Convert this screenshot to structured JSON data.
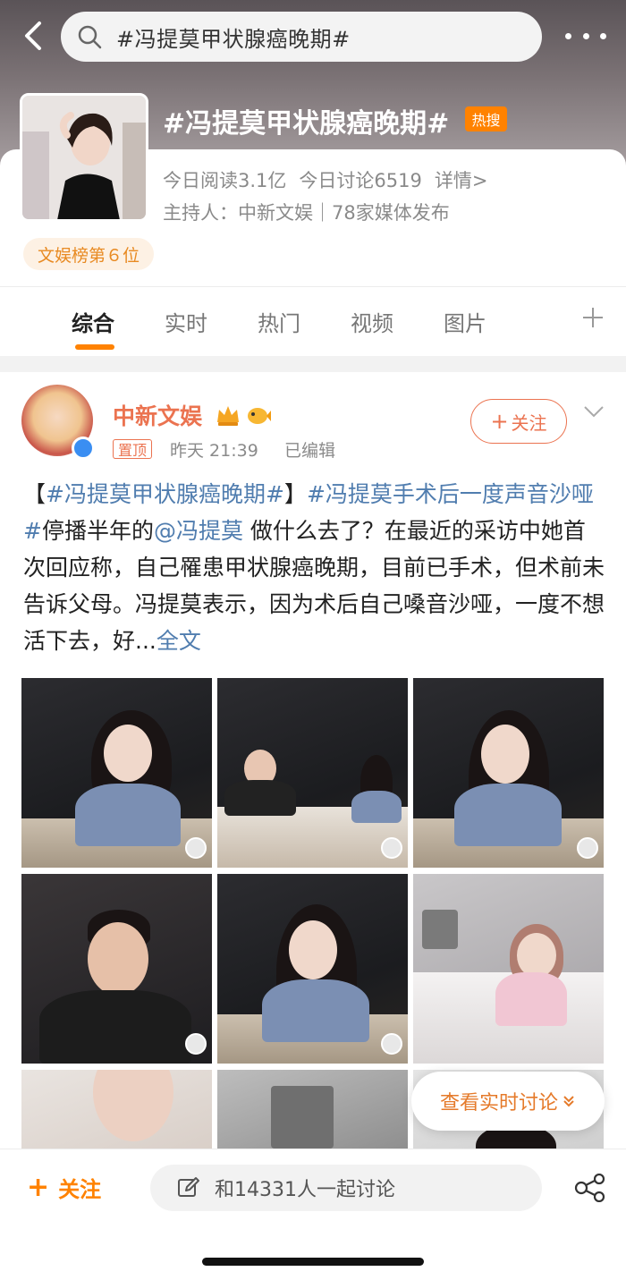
{
  "search": {
    "query": "#冯提莫甲状腺癌晚期#"
  },
  "topic": {
    "title": "#冯提莫甲状腺癌晚期#",
    "hot_badge": "热搜",
    "reads": "今日阅读3.1亿",
    "discussions": "今日讨论6519",
    "details": "详情>",
    "host": "主持人：中新文娱｜78家媒体发布",
    "rank": "文娱榜第６位"
  },
  "tabs": [
    {
      "label": "综合",
      "active": true
    },
    {
      "label": "实时",
      "active": false
    },
    {
      "label": "热门",
      "active": false
    },
    {
      "label": "视频",
      "active": false
    },
    {
      "label": "图片",
      "active": false
    }
  ],
  "post": {
    "author": "中新文娱",
    "pin_label": "置顶",
    "time": "昨天 21:39",
    "edited": "已编辑",
    "follow_label": "关注",
    "text": {
      "p1": "【",
      "tag1": "#冯提莫甲状腺癌晚期#",
      "p2": "】",
      "tag2": "#冯提莫手术后一度声音沙哑#",
      "p3": "停播半年的",
      "mention": "@冯提莫",
      "p4": " 做什么去了？在最近的采访中她首次回应称，自己罹患甲状腺癌晚期，目前已手术，但术前未告诉父母。冯提莫表示，因为术后自己嗓音沙哑，一度不想活下去，好...",
      "more": "全文"
    }
  },
  "live_discuss": "查看实时讨论",
  "bottom": {
    "follow_label": "关注",
    "discuss_placeholder": "和14331人一起讨论"
  },
  "colors": {
    "accent_orange": "#ff8200",
    "author_orange": "#eb7350",
    "link_blue": "#507daf"
  }
}
